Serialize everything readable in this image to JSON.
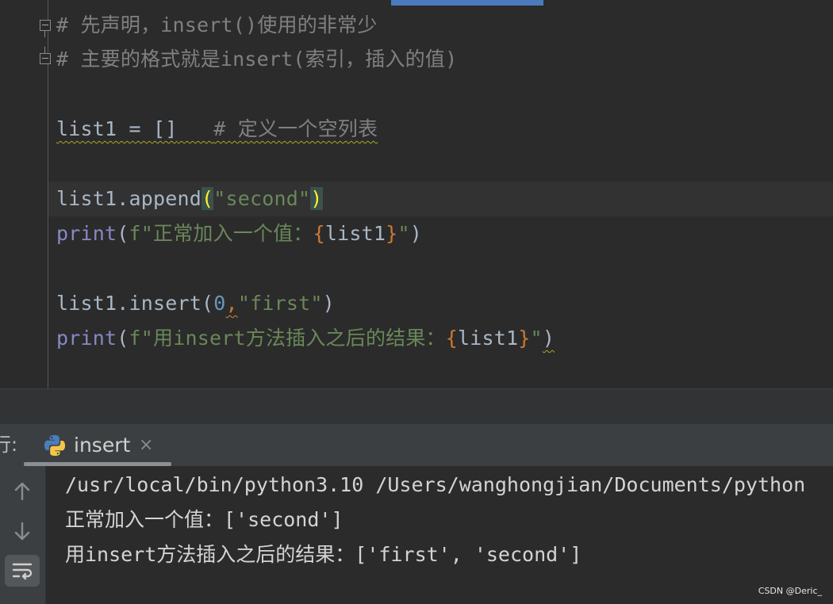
{
  "editor": {
    "lines": [
      {
        "comment": "# 先声明，insert()使用的非常少"
      },
      {
        "comment": "# 主要的格式就是insert(索引，插入的值)"
      },
      {
        "code": "list1 = []",
        "comment": "# 定义一个空列表"
      },
      {
        "obj": "list1.append",
        "open": "(",
        "str": "\"second\"",
        "close": ")"
      },
      {
        "fn": "print",
        "open": "(",
        "fstr_start": "f\"正常加入一个值：",
        "brace_open": "{",
        "var": "list1",
        "brace_close": "}",
        "fstr_end": "\"",
        "close": ")"
      },
      {
        "obj": "list1.insert",
        "open": "(",
        "num": "0",
        "comma": ",",
        "str": "\"first\"",
        "close": ")"
      },
      {
        "fn": "print",
        "open": "(",
        "fstr_start": "f\"用insert方法插入之后的结果：",
        "brace_open": "{",
        "var": "list1",
        "brace_close": "}",
        "fstr_end": "\"",
        "close": ")"
      }
    ]
  },
  "run_panel": {
    "label": "行:",
    "tab_label": "insert",
    "close_glyph": "×",
    "icons": {
      "tab": "python-icon",
      "close": "close-icon",
      "up": "arrow-up-icon",
      "down": "arrow-down-icon",
      "wrap": "soft-wrap-icon"
    }
  },
  "console": {
    "lines": [
      "/usr/local/bin/python3.10 /Users/wanghongjian/Documents/python",
      "正常加入一个值：['second']",
      "用insert方法插入之后的结果：['first', 'second']"
    ]
  },
  "watermark": "CSDN @Deric_",
  "colors": {
    "background": "#2b2b2b",
    "comment": "#808080",
    "string": "#6a8759",
    "number": "#6897bb",
    "builtin": "#8888c6",
    "brace": "#cc7832",
    "bracket_highlight": "#ffef28",
    "scroll_indicator": "#4b7bbd"
  }
}
